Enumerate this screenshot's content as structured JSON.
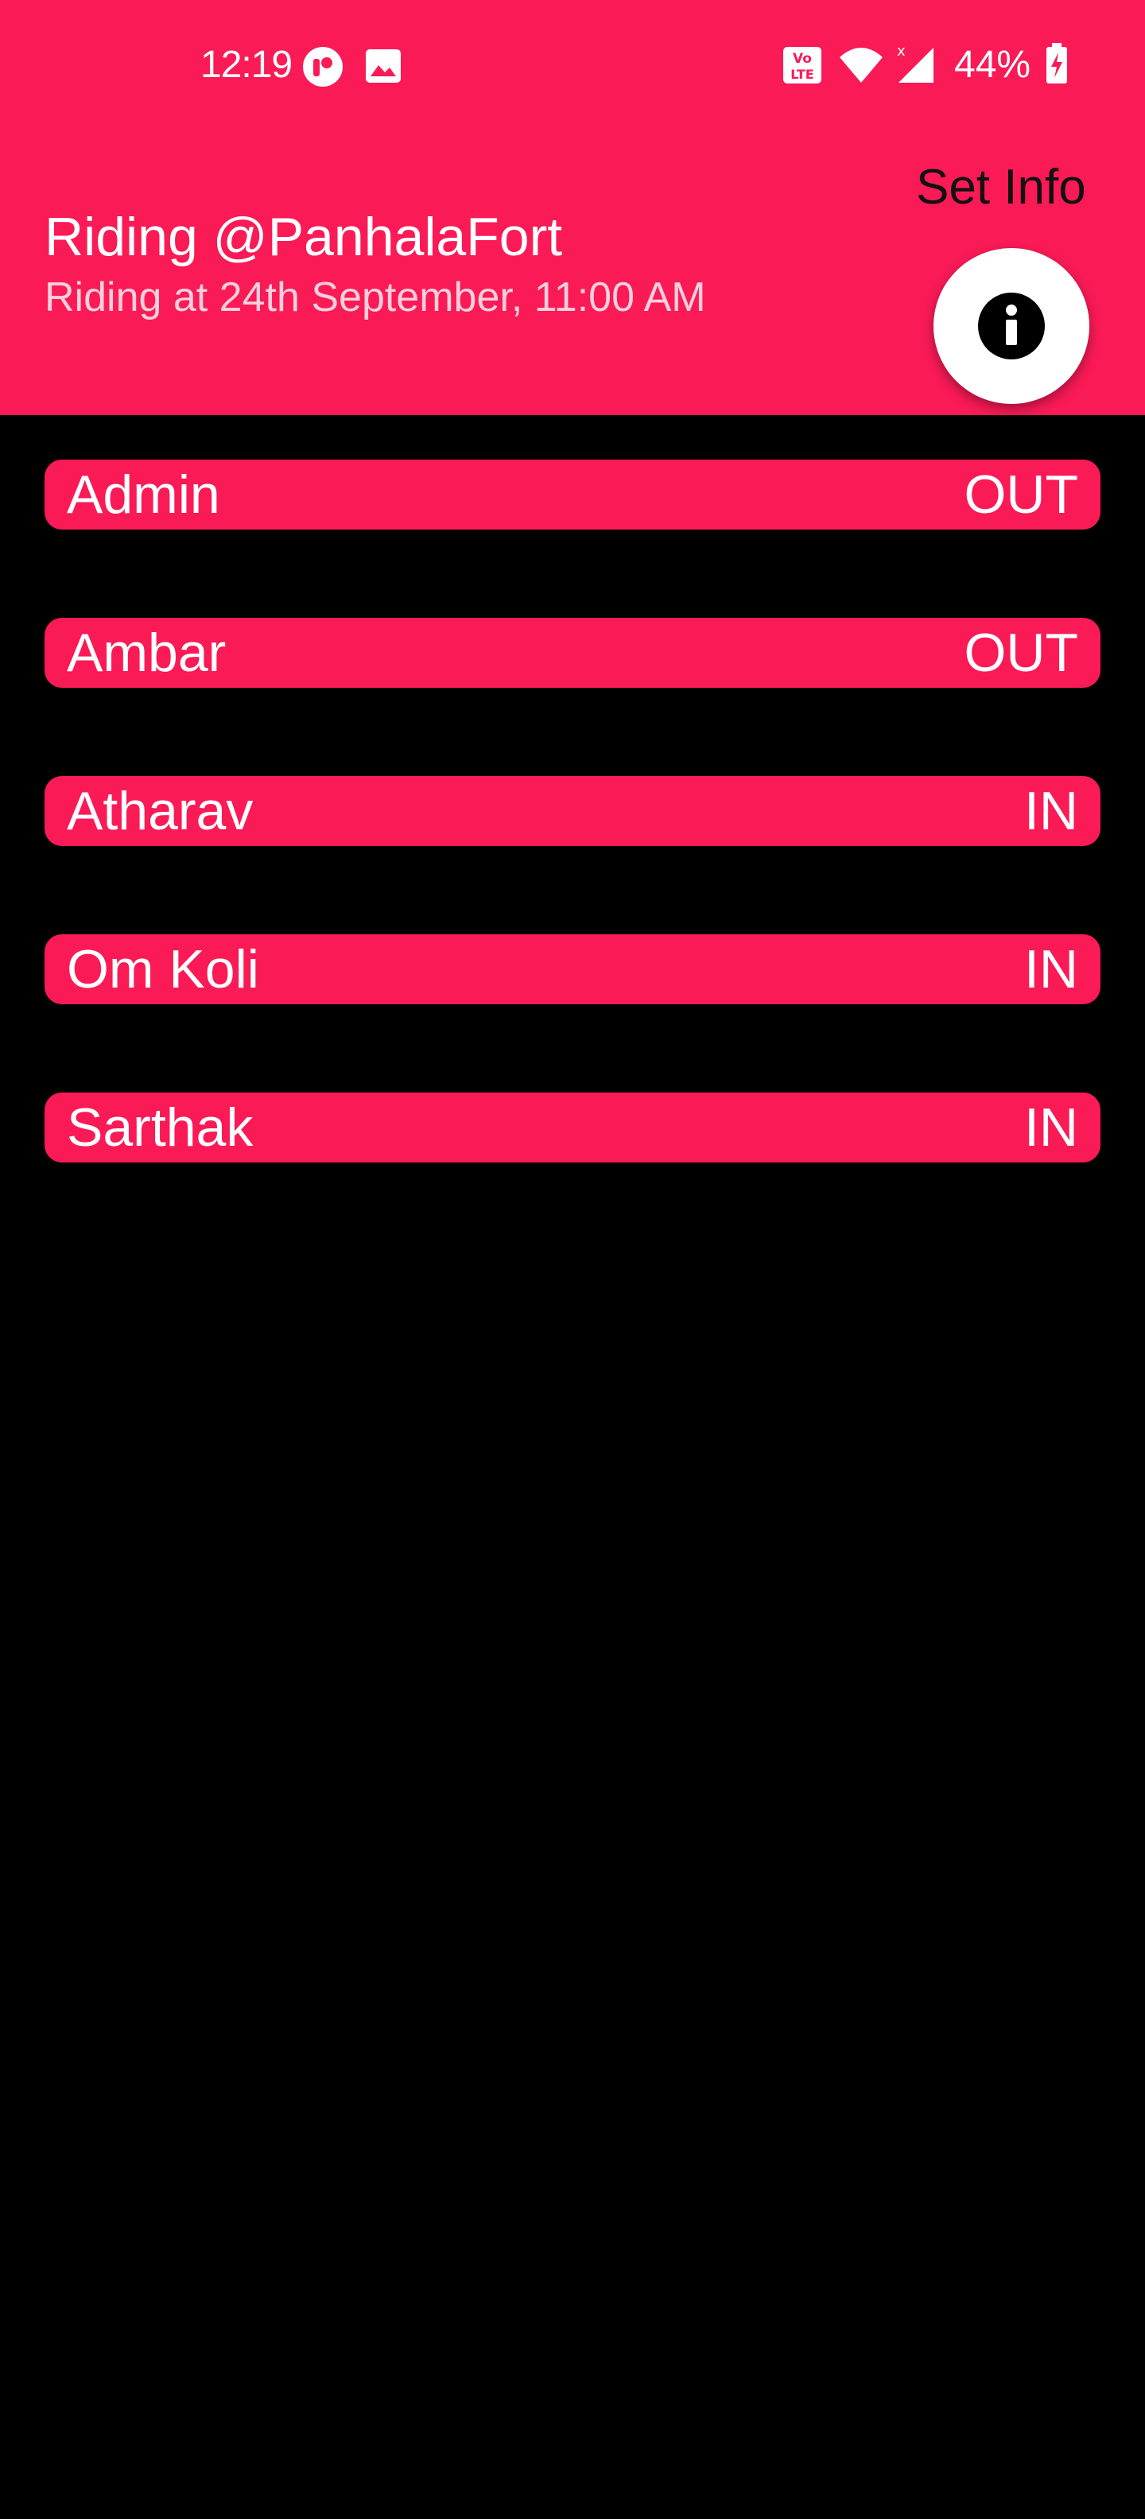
{
  "colors": {
    "accent": "#F91A56",
    "background": "#000000",
    "text_light": "#FFFFFF",
    "subtitle": "#FDCFDC",
    "set_info_text": "#111111"
  },
  "status_bar": {
    "time": "12:19",
    "battery": "44%",
    "icons": [
      "app-notification-icon",
      "image-notification-icon",
      "volte-icon",
      "wifi-icon",
      "cell-signal-icon",
      "battery-charging-icon"
    ]
  },
  "header": {
    "title": "Riding @PanhalaFort",
    "subtitle": "Riding at 24th September, 11:00 AM",
    "set_info_label": "Set Info",
    "fab_icon": "info-icon"
  },
  "members": [
    {
      "name": "Admin",
      "status": "OUT"
    },
    {
      "name": "Ambar",
      "status": "OUT"
    },
    {
      "name": "Atharav",
      "status": "IN"
    },
    {
      "name": "Om Koli",
      "status": "IN"
    },
    {
      "name": "Sarthak",
      "status": "IN"
    }
  ]
}
